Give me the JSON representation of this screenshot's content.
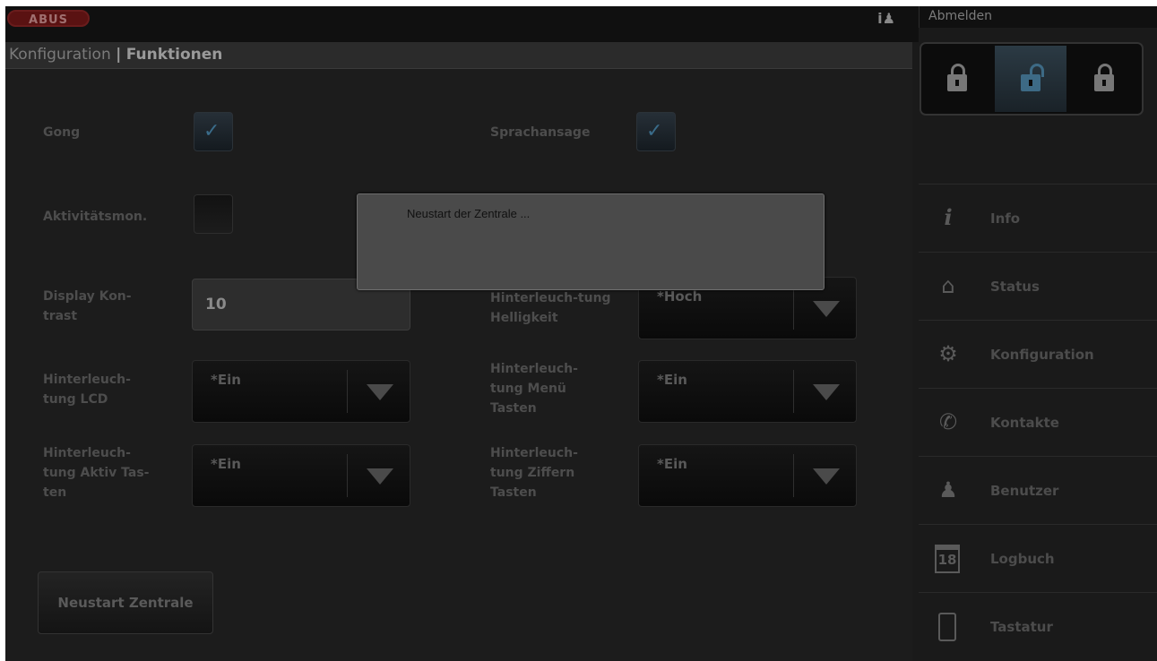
{
  "header": {
    "logo_text": "ABUS",
    "logout_label": "Abmelden"
  },
  "breadcrumb": {
    "section": "Konfiguration",
    "separator": "|",
    "page": "Funktionen"
  },
  "settings": {
    "gong_label": "Gong",
    "gong_checked": true,
    "voice_label": "Sprachansage",
    "voice_checked": true,
    "activity_label": "Aktivitätsmon.",
    "activity_checked": false,
    "contrast_label": "Display Kon-trast",
    "contrast_value": "10",
    "brightness_label": "Hinterleuch-tung Helligkeit",
    "brightness_value": "*Hoch",
    "lcd_label": "Hinterleuch-tung LCD",
    "lcd_value": "*Ein",
    "menu_keys_label": "Hinterleuch-tung Menü Tasten",
    "menu_keys_value": "*Ein",
    "active_keys_label": "Hinterleuch-tung Aktiv Tas-ten",
    "active_keys_value": "*Ein",
    "digit_keys_label": "Hinterleuch-tung Ziffern Tasten",
    "digit_keys_value": "*Ein",
    "restart_button": "Neustart Zentrale"
  },
  "dialog": {
    "message": "Neustart der Zentrale ..."
  },
  "sidebar": {
    "mode_active_index": 1,
    "items": [
      {
        "label": "Info",
        "icon": "info-icon"
      },
      {
        "label": "Status",
        "icon": "home-icon"
      },
      {
        "label": "Konfiguration",
        "icon": "gears-icon"
      },
      {
        "label": "Kontakte",
        "icon": "phone-book-icon"
      },
      {
        "label": "Benutzer",
        "icon": "user-icon"
      },
      {
        "label": "Logbuch",
        "icon": "calendar-icon"
      },
      {
        "label": "Tastatur",
        "icon": "keypad-icon"
      }
    ],
    "calendar_day": "18"
  },
  "colors": {
    "background": "#1a1a1a",
    "checkbox_accent": "#3a6c8a",
    "dialog_bg": "#4a4a4a"
  }
}
